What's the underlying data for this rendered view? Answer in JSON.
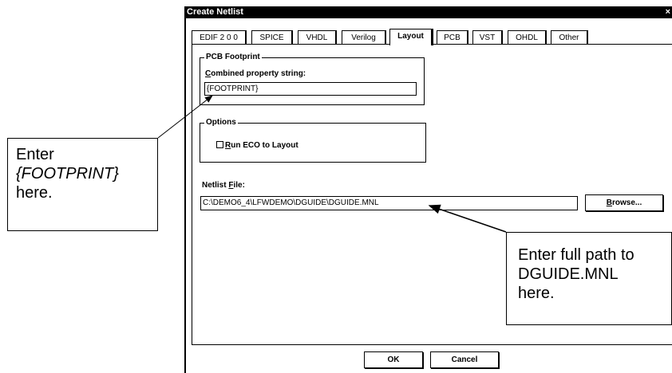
{
  "dialog": {
    "title": "Create Netlist",
    "close_glyph": "×",
    "tabs": [
      "EDIF 2 0 0",
      "SPICE",
      "VHDL",
      "Verilog",
      "Layout",
      "PCB",
      "VST",
      "OHDL",
      "Other"
    ],
    "active_tab": "Layout",
    "pcb_footprint": {
      "legend": "PCB Footprint",
      "label_prefix": "C",
      "label_rest": "ombined property string:",
      "value": "{FOOTPRINT}"
    },
    "options": {
      "legend": "Options",
      "run_eco_prefix": "R",
      "run_eco_rest": "un ECO to Layout",
      "run_eco_checked": false
    },
    "netlist_file": {
      "label_text": "Netlist ",
      "label_u": "F",
      "label_rest": "ile:",
      "value": "C:\\DEMO6_4\\LFWDEMO\\DGUIDE\\DGUIDE.MNL"
    },
    "browse_prefix": "B",
    "browse_rest": "rowse...",
    "ok_label": "OK",
    "cancel_label": "Cancel"
  },
  "callouts": {
    "left": {
      "line1": "Enter",
      "line2": "{FOOTPRINT}",
      "line3": "here."
    },
    "right": {
      "line1": "Enter full path to",
      "line2": "DGUIDE.MNL",
      "line3": "here."
    }
  }
}
